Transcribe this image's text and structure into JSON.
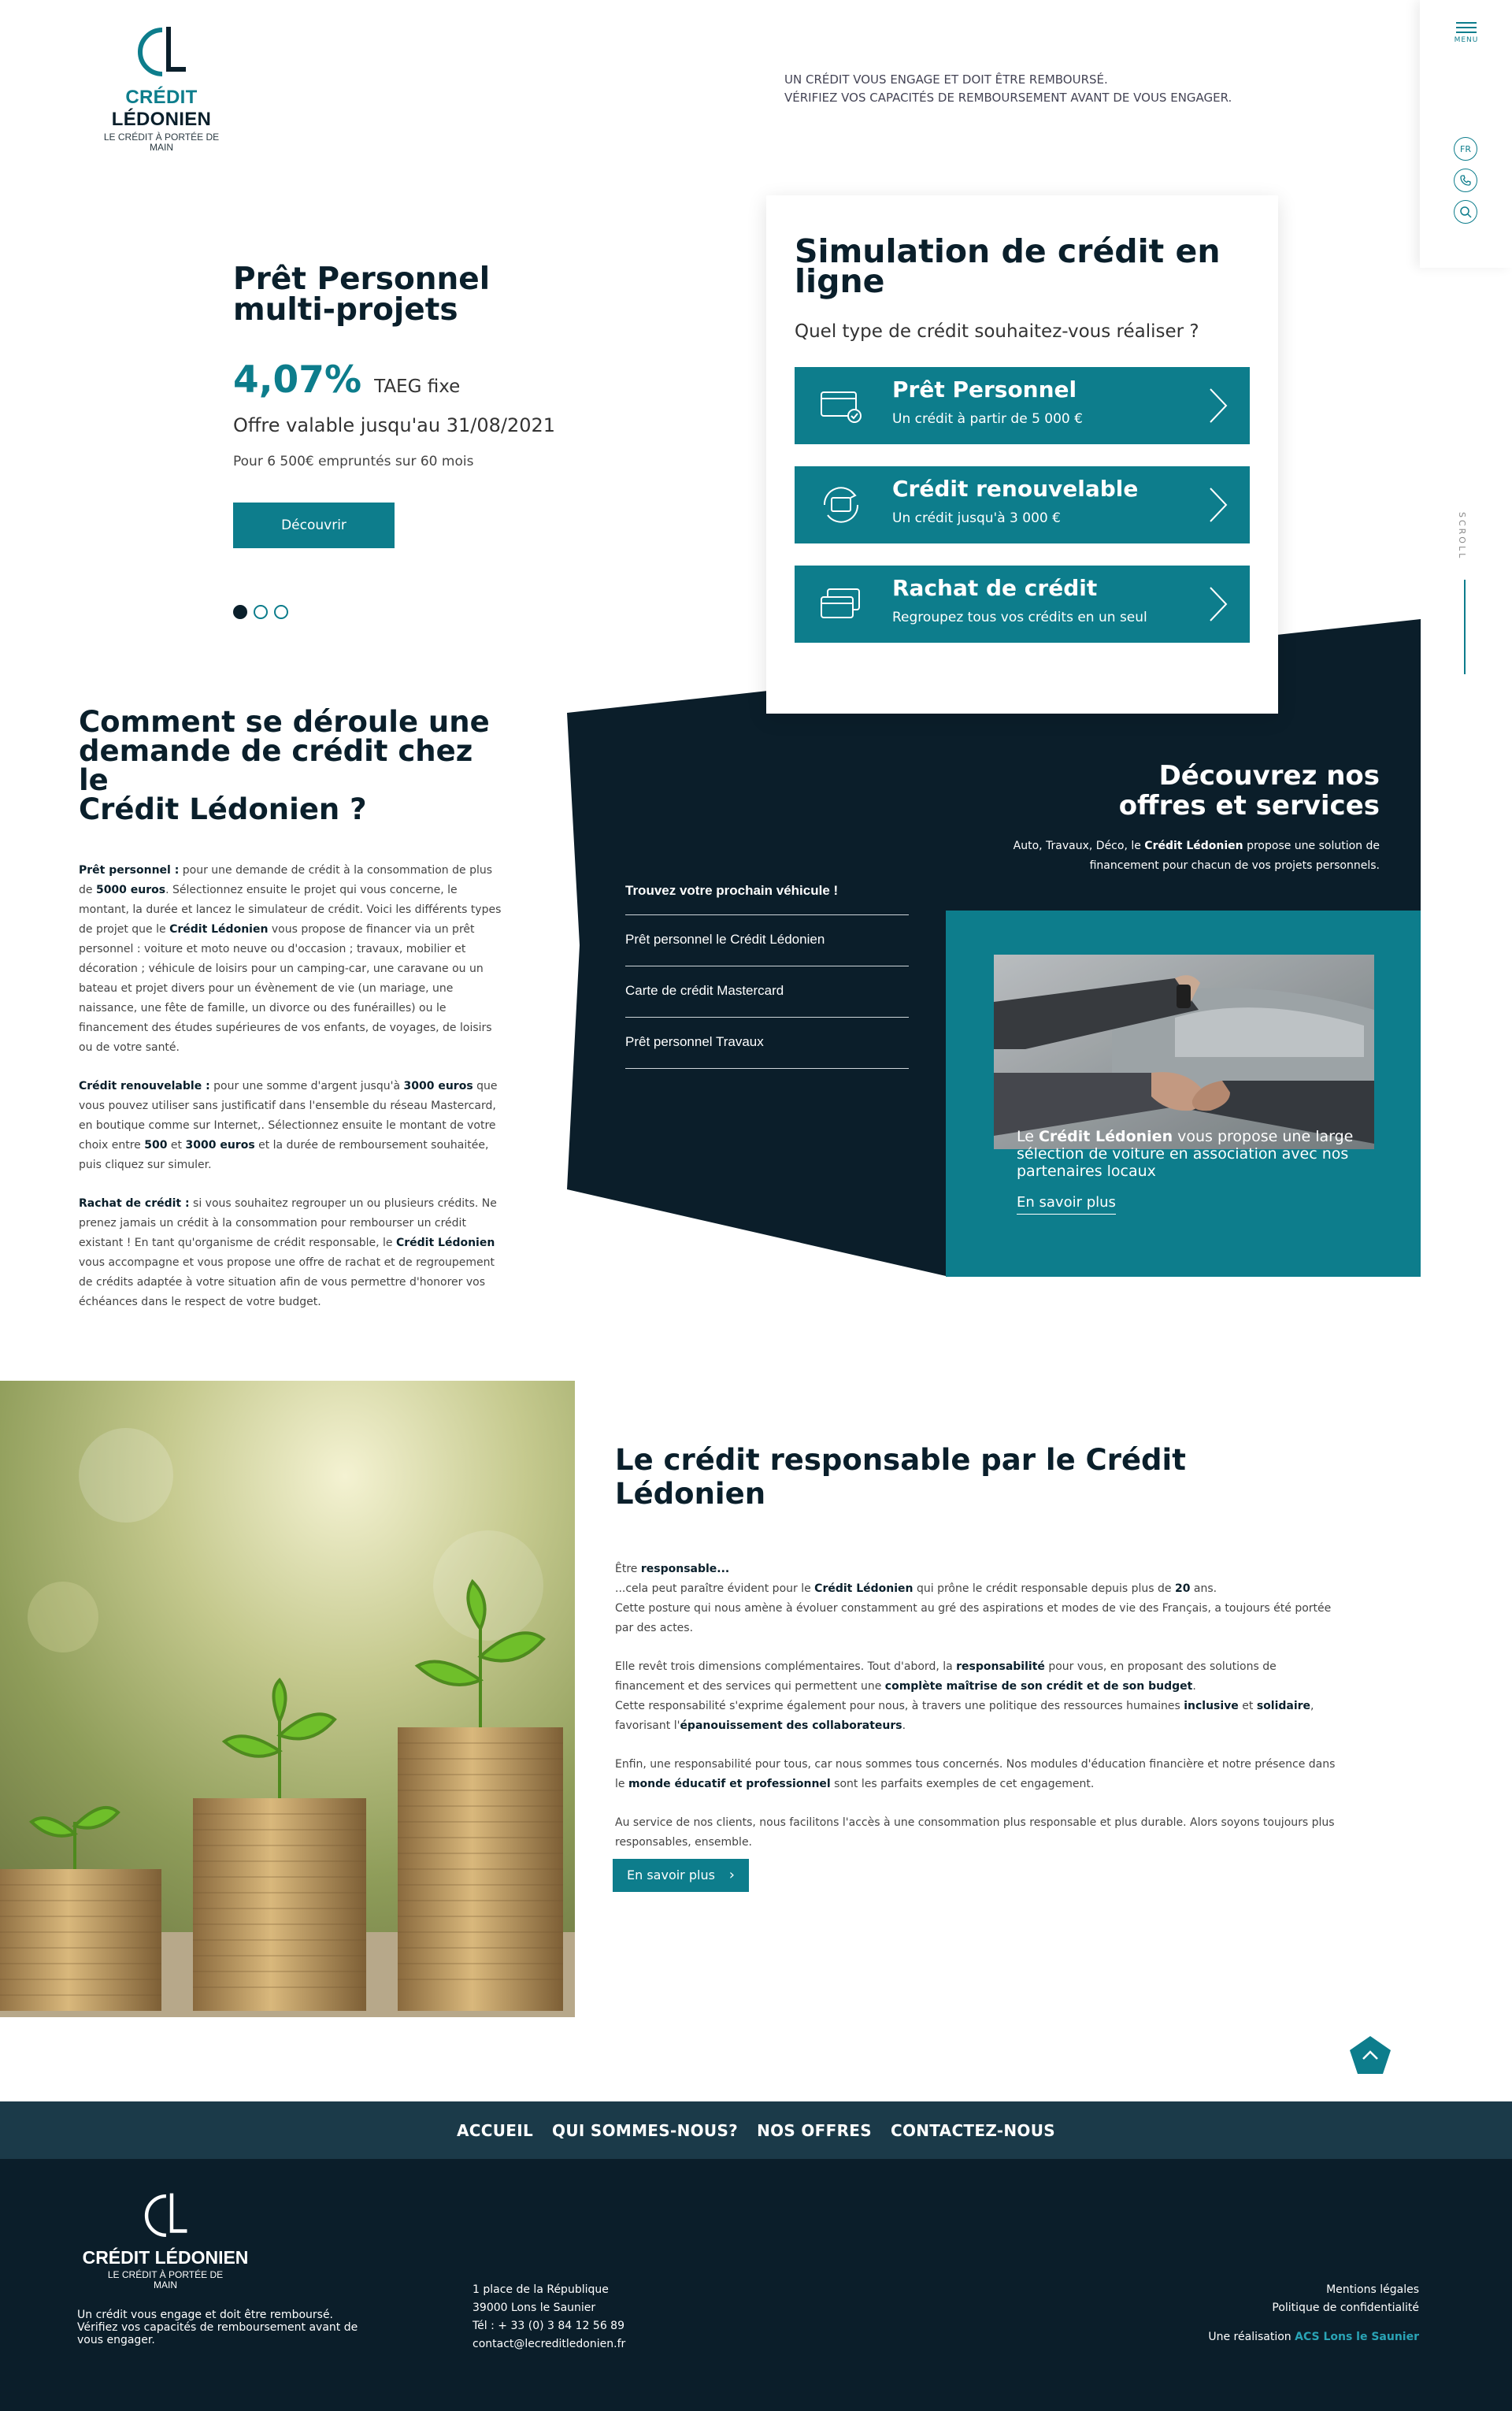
{
  "brand": {
    "name_part1": "CRÉDIT",
    "name_part2": "LÉDONIEN",
    "tagline": "LE CRÉDIT À PORTÉE DE MAIN",
    "teal": "#0d7d8c",
    "navy": "#0a1f2b"
  },
  "header": {
    "legal_line1": "UN CRÉDIT VOUS ENGAGE ET DOIT ÊTRE REMBOURSÉ.",
    "legal_line2": "VÉRIFIEZ VOS CAPACITÉS DE REMBOURSEMENT AVANT DE VOUS ENGAGER."
  },
  "sidebar": {
    "menu_label": "MENU",
    "lang_label": "FR",
    "phone_icon": "phone-icon",
    "search_icon": "search-icon",
    "scroll_label": "SCROLL"
  },
  "hero": {
    "title_line1": "Prêt Personnel",
    "title_line2": "multi-projets",
    "rate": "4,07%",
    "rate_unit": "TAEG fixe",
    "offer": "Offre valable jusqu'au 31/08/2021",
    "condition": "Pour 6 500€ empruntés sur 60 mois",
    "button": "Découvrir"
  },
  "simulation": {
    "title_line1": "Simulation de crédit en",
    "title_line2": "ligne",
    "question": "Quel type de crédit souhaitez-vous réaliser ?",
    "options": [
      {
        "title": "Prêt Personnel",
        "subtitle": "Un crédit à partir de 5 000 €",
        "icon": "card-check-icon"
      },
      {
        "title": "Crédit renouvelable",
        "subtitle": "Un crédit jusqu'à 3 000 €",
        "icon": "card-cycle-icon"
      },
      {
        "title": "Rachat de crédit",
        "subtitle": "Regroupez tous vos crédits en un seul",
        "icon": "cards-stack-icon"
      }
    ]
  },
  "howto": {
    "title_line1": "Comment se déroule une",
    "title_line2": "demande de crédit chez le",
    "title_line3": "Crédit Lédonien ?",
    "p1": {
      "lead": "Prêt personnel :",
      "a": " pour une demande de crédit à la consommation de plus de ",
      "amount": "5000 euros",
      "b": ". Sélectionnez ensuite le projet qui vous concerne, le montant, la durée et lancez le simulateur de crédit. Voici les différents types de projet que le ",
      "brand": "Crédit Lédonien",
      "c": " vous propose de financer via un prêt personnel : voiture et moto neuve ou d'occasion ; travaux, mobilier et décoration ; véhicule de loisirs pour un camping-car, une caravane ou un bateau et projet divers pour un évènement de vie (un mariage, une naissance, une fête de famille, un divorce ou des funérailles) ou le financement des études supérieures de vos enfants, de voyages, de loisirs ou de votre santé."
    },
    "p2": {
      "lead": "Crédit renouvelable :",
      "a": " pour une somme d'argent jusqu'à ",
      "amount": "3000 euros",
      "b": " que vous pouvez utiliser sans justificatif dans l'ensemble du réseau Mastercard, en boutique comme sur Internet,. Sélectionnez ensuite le montant de votre choix entre ",
      "min": "500",
      "c": " et ",
      "max": "3000 euros",
      "d": " et la durée de remboursement souhaitée, puis cliquez sur simuler."
    },
    "p3": {
      "lead": "Rachat de crédit :",
      "a": " si vous souhaitez regrouper un ou plusieurs crédits. Ne prenez jamais un crédit à la consommation pour rembourser un crédit existant ! En tant qu'organisme de crédit responsable, le ",
      "brand": "Crédit Lédonien",
      "b": " vous accompagne et vous propose une offre de rachat et de regroupement de crédits adaptée à votre situation afin de vous permettre d'honorer vos échéances dans le respect de votre budget."
    }
  },
  "offers": {
    "title_line1": "Découvrez nos",
    "title_line2": "offres et services",
    "intro_a": "Auto, Travaux, Déco, le ",
    "intro_brand": "Crédit Lédonien",
    "intro_b": " propose une solution de financement pour chacun de vos projets personnels.",
    "links": [
      "Trouvez votre prochain véhicule !",
      "Prêt personnel le Crédit Lédonien",
      "Carte de crédit Mastercard",
      "Prêt personnel Travaux"
    ],
    "card_a": "Le ",
    "card_brand": "Crédit Lédonien",
    "card_b": " vous propose une large sélection de voiture en association avec nos partenaires locaux",
    "card_more": "En savoir plus"
  },
  "responsible": {
    "title": "Le crédit responsable par le Crédit Lédonien",
    "p1_a": "Être ",
    "p1_b": "responsable...",
    "p1_c": "...cela peut paraître évident pour le ",
    "p1_brand": "Crédit Lédonien",
    "p1_d": " qui prône le crédit responsable depuis plus de ",
    "p1_years": "20",
    "p1_e": " ans.",
    "p1_f": "Cette posture qui nous amène à évoluer constamment au gré des aspirations et modes de vie des Français, a toujours été portée par des actes.",
    "p2_a": "Elle revêt trois dimensions complémentaires. Tout d'abord, la ",
    "p2_b": "responsabilité",
    "p2_c": " pour vous, en proposant des solutions de financement et des services qui permettent une ",
    "p2_d": "complète maîtrise de son crédit et de son budget",
    "p2_e": ".",
    "p2_f": "Cette responsabilité s'exprime également pour nous, à travers une politique des ressources humaines ",
    "p2_g": "inclusive",
    "p2_h": " et ",
    "p2_i": "solidaire",
    "p2_j": ", favorisant l'",
    "p2_k": "épanouissement des collaborateurs",
    "p2_l": ".",
    "p3_a": "Enfin, une responsabilité pour tous, car nous sommes tous concernés. Nos modules d'éducation financière et notre présence dans le ",
    "p3_b": "monde éducatif et professionnel",
    "p3_c": " sont les parfaits exemples de cet engagement.",
    "p4": "Au service de nos clients, nous facilitons l'accès à une consommation plus responsable et plus durable. Alors soyons toujours plus responsables, ensemble.",
    "button": "En savoir plus"
  },
  "nav": [
    "ACCUEIL",
    "QUI SOMMES-NOUS?",
    "NOS OFFRES",
    "CONTACTEZ-NOUS"
  ],
  "footer": {
    "brand": "CRÉDIT LÉDONIEN",
    "tagline": "LE CRÉDIT À PORTÉE DE MAIN",
    "motto": "Un crédit vous engage et doit être remboursé. Vérifiez vos capacités de remboursement avant de vous engager.",
    "address1": "1 place de la République",
    "address2": "39000 Lons le Saunier",
    "phone": "Tél : + 33 (0) 3 84 12 56 89",
    "email": "contact@lecreditledonien.fr",
    "legal1": "Mentions légales",
    "legal2": "Politique de confidentialité",
    "credit_a": "Une réalisation ",
    "credit_b": "ACS Lons le Saunier"
  }
}
